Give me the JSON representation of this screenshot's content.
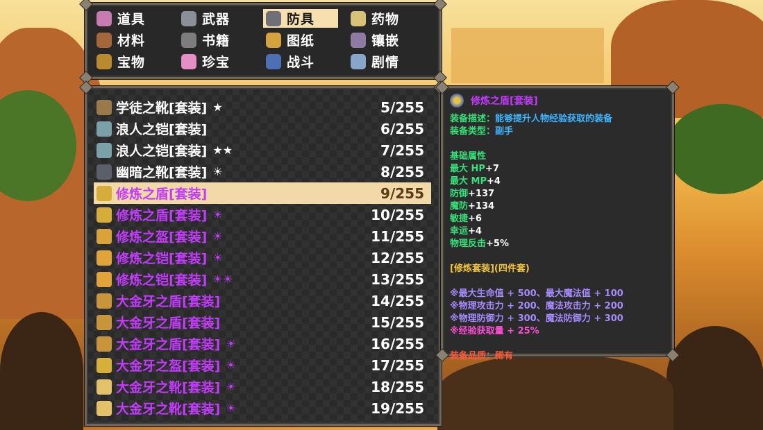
{
  "categories": [
    {
      "label": "道具",
      "icon": "bag-icon",
      "color": "#c77bb0"
    },
    {
      "label": "武器",
      "icon": "axe-icon",
      "color": "#8a8f98"
    },
    {
      "label": "防具",
      "icon": "armor-icon",
      "color": "#6f6f77",
      "selected": true
    },
    {
      "label": "药物",
      "icon": "potion-icon",
      "color": "#d8c27a"
    },
    {
      "label": "材料",
      "icon": "wood-icon",
      "color": "#a5663a"
    },
    {
      "label": "书籍",
      "icon": "book-icon",
      "color": "#7d7d7d"
    },
    {
      "label": "图纸",
      "icon": "scroll-icon",
      "color": "#d6a23e"
    },
    {
      "label": "镶嵌",
      "icon": "grid-icon",
      "color": "#8e7aa3"
    },
    {
      "label": "宝物",
      "icon": "chest-icon",
      "color": "#b98a2e"
    },
    {
      "label": "珍宝",
      "icon": "gift-icon",
      "color": "#e58fc6"
    },
    {
      "label": "战斗",
      "icon": "knight-icon",
      "color": "#4e6fb3"
    },
    {
      "label": "剧情",
      "icon": "open-book-icon",
      "color": "#89a6c8"
    }
  ],
  "items": [
    {
      "name": "学徒之靴[套装]",
      "mark": "★",
      "count": "5/255",
      "color": "white",
      "icon": "boots-icon",
      "icon_color": "#9a7a4a"
    },
    {
      "name": "浪人之铠[套装]",
      "mark": "",
      "count": "6/255",
      "color": "white",
      "icon": "armor-icon",
      "icon_color": "#7aa0a8"
    },
    {
      "name": "浪人之铠[套装]",
      "mark": "★★",
      "count": "7/255",
      "color": "white",
      "icon": "armor-icon",
      "icon_color": "#7aa0a8"
    },
    {
      "name": "幽暗之靴[套装]",
      "mark": "☀",
      "count": "8/255",
      "color": "white",
      "icon": "boots-icon",
      "icon_color": "#5a5f6a"
    },
    {
      "name": "修炼之盾[套装]",
      "mark": "",
      "count": "9/255",
      "color": "purple",
      "icon": "shield-icon",
      "icon_color": "#d6ad3a",
      "selected": true
    },
    {
      "name": "修炼之盾[套装]",
      "mark": "☀",
      "count": "10/255",
      "color": "purple",
      "icon": "shield-icon",
      "icon_color": "#d6ad3a"
    },
    {
      "name": "修炼之盔[套装]",
      "mark": "☀",
      "count": "11/255",
      "color": "purple",
      "icon": "helmet-icon",
      "icon_color": "#d9a33a"
    },
    {
      "name": "修炼之铠[套装]",
      "mark": "☀",
      "count": "12/255",
      "color": "purple",
      "icon": "armor-icon",
      "icon_color": "#e0a43a"
    },
    {
      "name": "修炼之铠[套装]",
      "mark": "☀☀",
      "count": "13/255",
      "color": "purple",
      "icon": "armor-icon",
      "icon_color": "#e0a43a"
    },
    {
      "name": "大金牙之盾[套装]",
      "mark": "",
      "count": "14/255",
      "color": "purple",
      "icon": "shield-icon",
      "icon_color": "#c9953a"
    },
    {
      "name": "大金牙之盾[套装]",
      "mark": "",
      "count": "15/255",
      "color": "purple",
      "icon": "shield-icon",
      "icon_color": "#c9953a"
    },
    {
      "name": "大金牙之盾[套装]",
      "mark": "☀",
      "count": "16/255",
      "color": "purple",
      "icon": "shield-icon",
      "icon_color": "#c9953a"
    },
    {
      "name": "大金牙之盔[套装]",
      "mark": "☀",
      "count": "17/255",
      "color": "purple",
      "icon": "crown-icon",
      "icon_color": "#d6b03a"
    },
    {
      "name": "大金牙之靴[套装]",
      "mark": "☀",
      "count": "18/255",
      "color": "purple",
      "icon": "boots-icon",
      "icon_color": "#e3c26a"
    },
    {
      "name": "大金牙之靴[套装]",
      "mark": "☀",
      "count": "19/255",
      "color": "purple",
      "icon": "boots-icon",
      "icon_color": "#e3c26a"
    }
  ],
  "detail": {
    "title": "修炼之盾[套装]",
    "desc_label": "装备描述：",
    "desc_value": "能够提升人物经验获取的装备",
    "type_label": "装备类型：",
    "type_value": "副手",
    "base_header": "基础属性",
    "stats": [
      {
        "label": "最大 HP",
        "value": "+7"
      },
      {
        "label": "最大 MP",
        "value": "+4"
      },
      {
        "label": "防御",
        "value": "+137"
      },
      {
        "label": "魔防",
        "value": "+134"
      },
      {
        "label": "敏捷",
        "value": "+6"
      },
      {
        "label": "幸运",
        "value": "+4"
      },
      {
        "label": "物理反击",
        "value": "+5%"
      }
    ],
    "set_header": "[修炼套装](四件套)",
    "set_bonus": [
      {
        "text": "※最大生命值 + 500、最大魔法值 + 100",
        "color": "lilac"
      },
      {
        "text": "※物理攻击力 + 200、魔法攻击力 + 200",
        "color": "lilac"
      },
      {
        "text": "※物理防御力 + 300、魔法防御力 + 300",
        "color": "lilac"
      },
      {
        "text": "※经验获取量 + 25%",
        "color": "pink"
      }
    ],
    "quality_label": "装备品质：",
    "quality_value": "稀有"
  }
}
